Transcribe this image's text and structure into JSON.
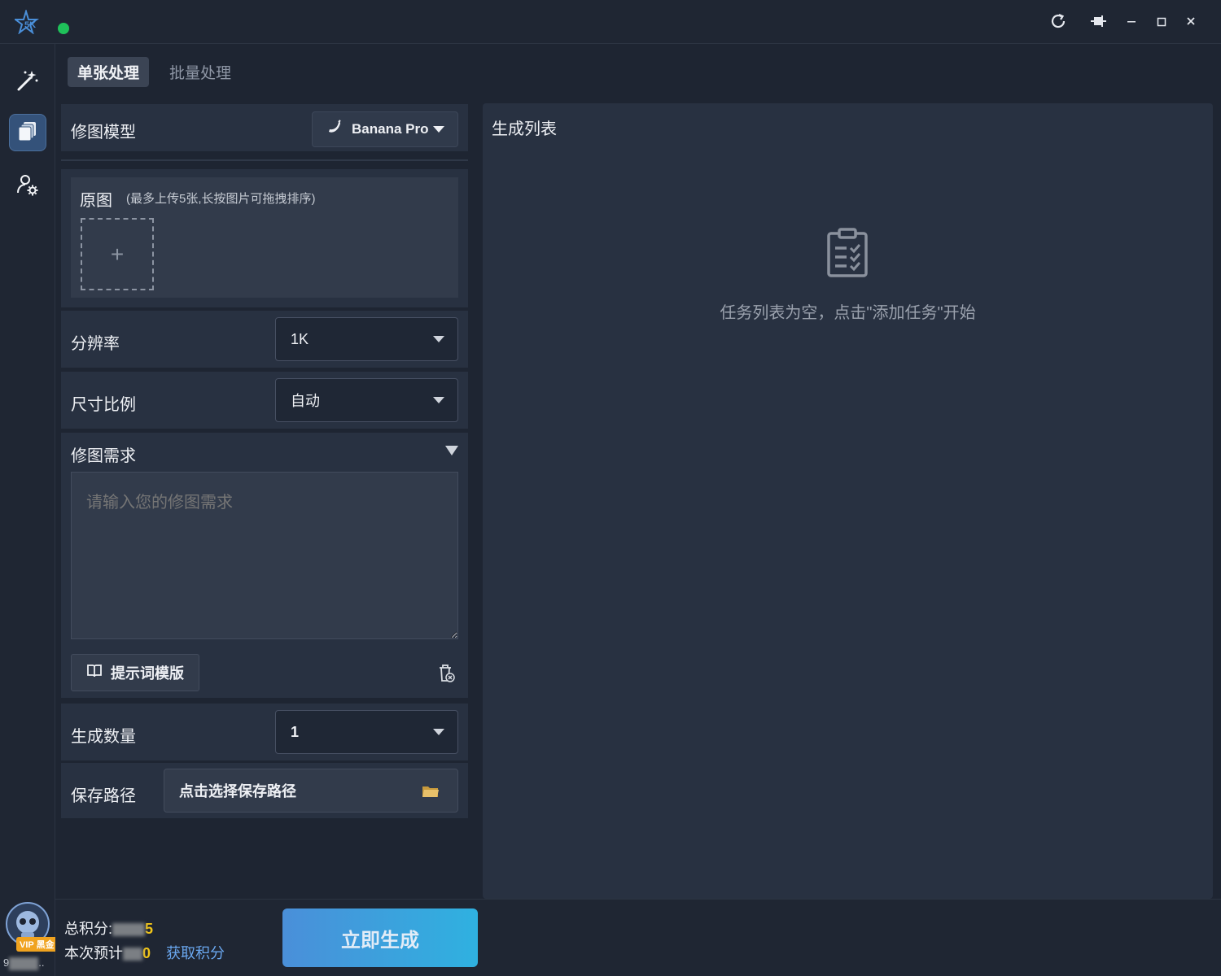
{
  "colors": {
    "background": "#1e2532",
    "panel": "#283141",
    "accent": "#4a8fd9",
    "status_online": "#1fc15a",
    "points_highlight": "#f0c419",
    "link": "#6aa7ef"
  },
  "titlebar": {
    "logo_icon": "app-logo-star",
    "status": "online",
    "buttons": [
      "refresh-icon",
      "pin-icon",
      "minimize-icon",
      "maximize-icon",
      "close-icon"
    ]
  },
  "sidebar": {
    "items": [
      {
        "icon": "magic-wand-icon",
        "active": false
      },
      {
        "icon": "layers-icon",
        "active": true
      },
      {
        "icon": "user-settings-icon",
        "active": false
      }
    ]
  },
  "tabs": [
    {
      "label": "单张处理",
      "active": true
    },
    {
      "label": "批量处理",
      "active": false
    }
  ],
  "model": {
    "label": "修图模型",
    "value": "Banana Pro",
    "icon": "banana-icon"
  },
  "source": {
    "label": "原图",
    "hint": "(最多上传5张,长按图片可拖拽排序)",
    "add_glyph": "+"
  },
  "resolution": {
    "label": "分辨率",
    "value": "1K"
  },
  "ratio": {
    "label": "尺寸比例",
    "value": "自动"
  },
  "requirement": {
    "label": "修图需求",
    "placeholder": "请输入您的修图需求",
    "template_button": "提示词模版"
  },
  "count": {
    "label": "生成数量",
    "value": "1"
  },
  "save_path": {
    "label": "保存路径",
    "placeholder": "点击选择保存路径"
  },
  "generate_list": {
    "title": "生成列表",
    "empty_text": "任务列表为空，点击\"添加任务\"开始"
  },
  "footer": {
    "total_points_label": "总积分:",
    "total_points_suffix": "5",
    "estimate_label": "本次预计",
    "estimate_suffix": "0",
    "get_points": "获取积分",
    "vip_badge": "VIP 黑金",
    "generate_button": "立即生成",
    "account_prefix": "9",
    "account_suffix": ".."
  }
}
